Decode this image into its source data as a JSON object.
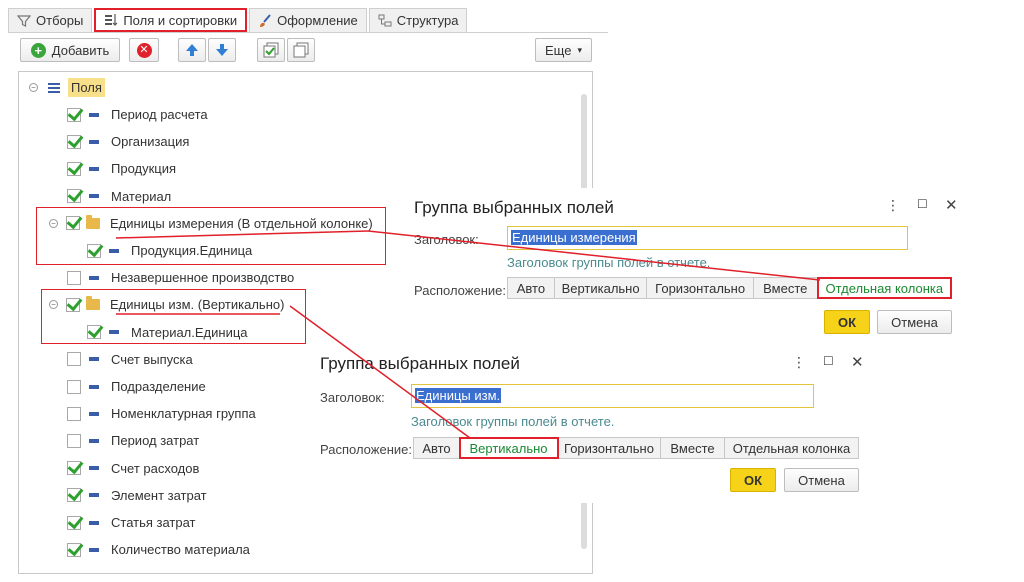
{
  "tabs": [
    {
      "label": "Отборы",
      "icon": "filter-icon"
    },
    {
      "label": "Поля и сортировки",
      "icon": "fields-sort-icon",
      "active": true
    },
    {
      "label": "Оформление",
      "icon": "brush-icon"
    },
    {
      "label": "Структура",
      "icon": "structure-icon"
    }
  ],
  "toolbar": {
    "add_label": "Добавить",
    "more_label": "Еще"
  },
  "tree": {
    "root_label": "Поля",
    "rows": [
      {
        "label": "Период расчета",
        "checked": true
      },
      {
        "label": "Организация",
        "checked": true
      },
      {
        "label": "Продукция",
        "checked": true
      },
      {
        "label": "Материал",
        "checked": true
      },
      {
        "label": "Единицы измерения (В отдельной колонке)",
        "checked": true,
        "group": true
      },
      {
        "label": "Продукция.Единица",
        "checked": true,
        "child": true
      },
      {
        "label": "Незавершенное производство",
        "checked": false
      },
      {
        "label": "Единицы изм. (Вертикально)",
        "checked": true,
        "group": true
      },
      {
        "label": "Материал.Единица",
        "checked": true,
        "child": true
      },
      {
        "label": "Счет выпуска",
        "checked": false
      },
      {
        "label": "Подразделение",
        "checked": false
      },
      {
        "label": "Номенклатурная группа",
        "checked": false
      },
      {
        "label": "Период затрат",
        "checked": false
      },
      {
        "label": "Счет расходов",
        "checked": true
      },
      {
        "label": "Элемент затрат",
        "checked": true
      },
      {
        "label": "Статья затрат",
        "checked": true
      },
      {
        "label": "Количество материала",
        "checked": true
      }
    ]
  },
  "dialog1": {
    "title": "Группа выбранных полей",
    "header_label": "Заголовок:",
    "header_value": "Единицы измерения",
    "hint": "Заголовок группы полей в отчете.",
    "placement_label": "Расположение:",
    "options": [
      "Авто",
      "Вертикально",
      "Горизонтально",
      "Вместе",
      "Отдельная колонка"
    ],
    "selected": "Отдельная колонка",
    "ok": "ОК",
    "cancel": "Отмена"
  },
  "dialog2": {
    "title": "Группа выбранных полей",
    "header_label": "Заголовок:",
    "header_value": "Единицы изм.",
    "hint": "Заголовок группы полей в отчете.",
    "placement_label": "Расположение:",
    "options": [
      "Авто",
      "Вертикально",
      "Горизонтально",
      "Вместе",
      "Отдельная колонка"
    ],
    "selected": "Вертикально",
    "ok": "ОК",
    "cancel": "Отмена"
  },
  "colors": {
    "accent_red": "#e0202a",
    "check_green": "#2ea02e",
    "ok_yellow": "#f6d218",
    "selection_blue": "#3a6fd0"
  }
}
